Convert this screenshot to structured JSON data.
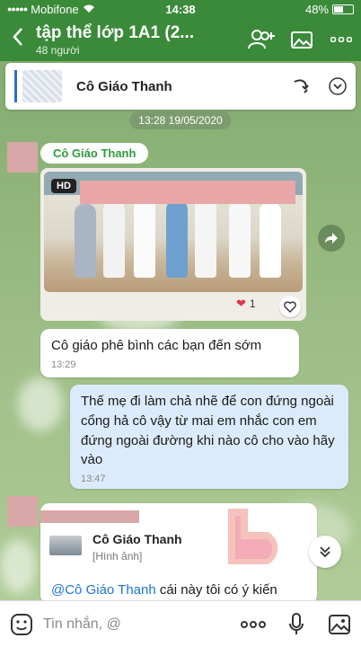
{
  "status_bar": {
    "carrier": "Mobifone",
    "time": "14:38",
    "battery": "48%"
  },
  "header": {
    "title": "tập thể lớp 1A1 (2...",
    "subtitle": "48 người",
    "icons": [
      "back-arrow-icon",
      "add-member-icon",
      "album-icon",
      "more-icon"
    ]
  },
  "pinned": {
    "name": "Cô Giáo Thanh"
  },
  "timestamp": "13:28 19/05/2020",
  "messages": {
    "photo": {
      "sender": "Cô Giáo Thanh",
      "badge": "HD",
      "reaction_count": "1"
    },
    "text1": {
      "text": "Cô giáo phê bình các bạn đến sớm",
      "time": "13:29"
    },
    "text2": {
      "text": "Thế mẹ đi làm chả nhẽ để con đứng ngoài cổng hả cô vậy từ mai em nhắc con em đứng ngoài đường khi nào cô cho vào hãy vào",
      "time": "13:47"
    },
    "reply": {
      "quoted_name": "Cô Giáo Thanh",
      "quoted_type": "[Hình ảnh]",
      "mention": "@Cô Giáo Thanh",
      "text": " cái này tôi có ý kiến"
    }
  },
  "input": {
    "placeholder": "Tin nhắn, @"
  },
  "colors": {
    "header": "#3a8a3a",
    "sender_name": "#2f9a3b",
    "mention": "#1e73d8",
    "outgoing_bubble": "#dcebfb"
  }
}
